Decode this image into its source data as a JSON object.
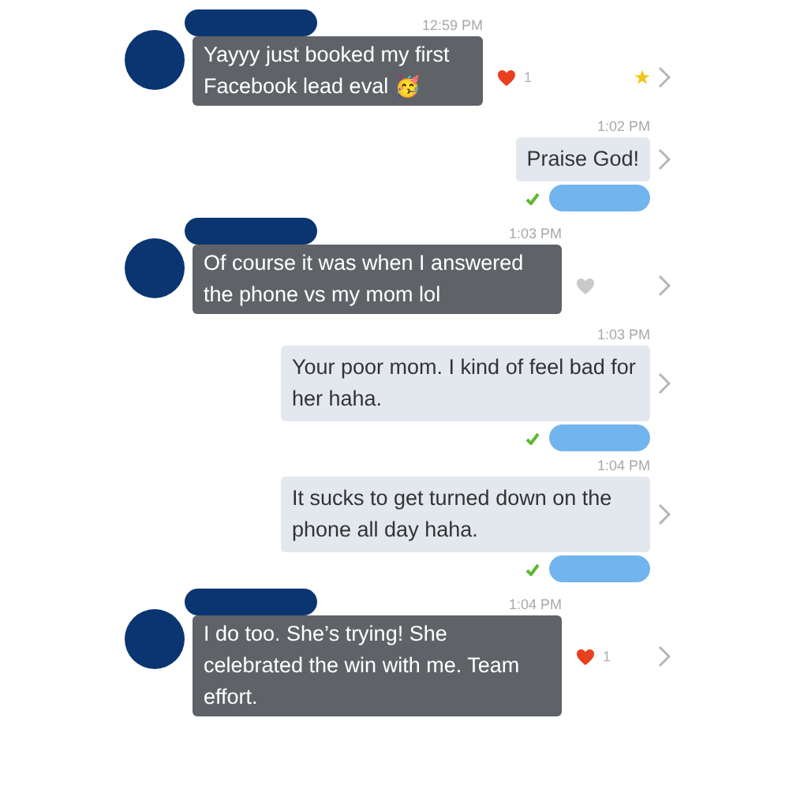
{
  "messages": [
    {
      "kind": "incoming",
      "time": "12:59 PM",
      "text": "Yayyy just booked my first Facebook lead eval 🥳",
      "liked": true,
      "like_count": "1",
      "starred": true
    },
    {
      "kind": "outgoing",
      "time": "1:02 PM",
      "text": "Praise God!",
      "delivered": true
    },
    {
      "kind": "incoming",
      "time": "1:03 PM",
      "text": "Of course it was when I answered the phone vs my mom lol",
      "liked": false,
      "starred": false
    },
    {
      "kind": "outgoing",
      "time": "1:03 PM",
      "text": "Your poor mom. I kind of feel bad for her haha.",
      "delivered": true
    },
    {
      "kind": "outgoing",
      "time": "1:04 PM",
      "text": "It sucks to get turned down on the phone all day haha.",
      "delivered": true
    },
    {
      "kind": "incoming",
      "time": "1:04 PM",
      "text": "I do too. She’s trying! She celebrated the win with me. Team effort.",
      "liked": true,
      "like_count": "1",
      "starred": false
    }
  ]
}
